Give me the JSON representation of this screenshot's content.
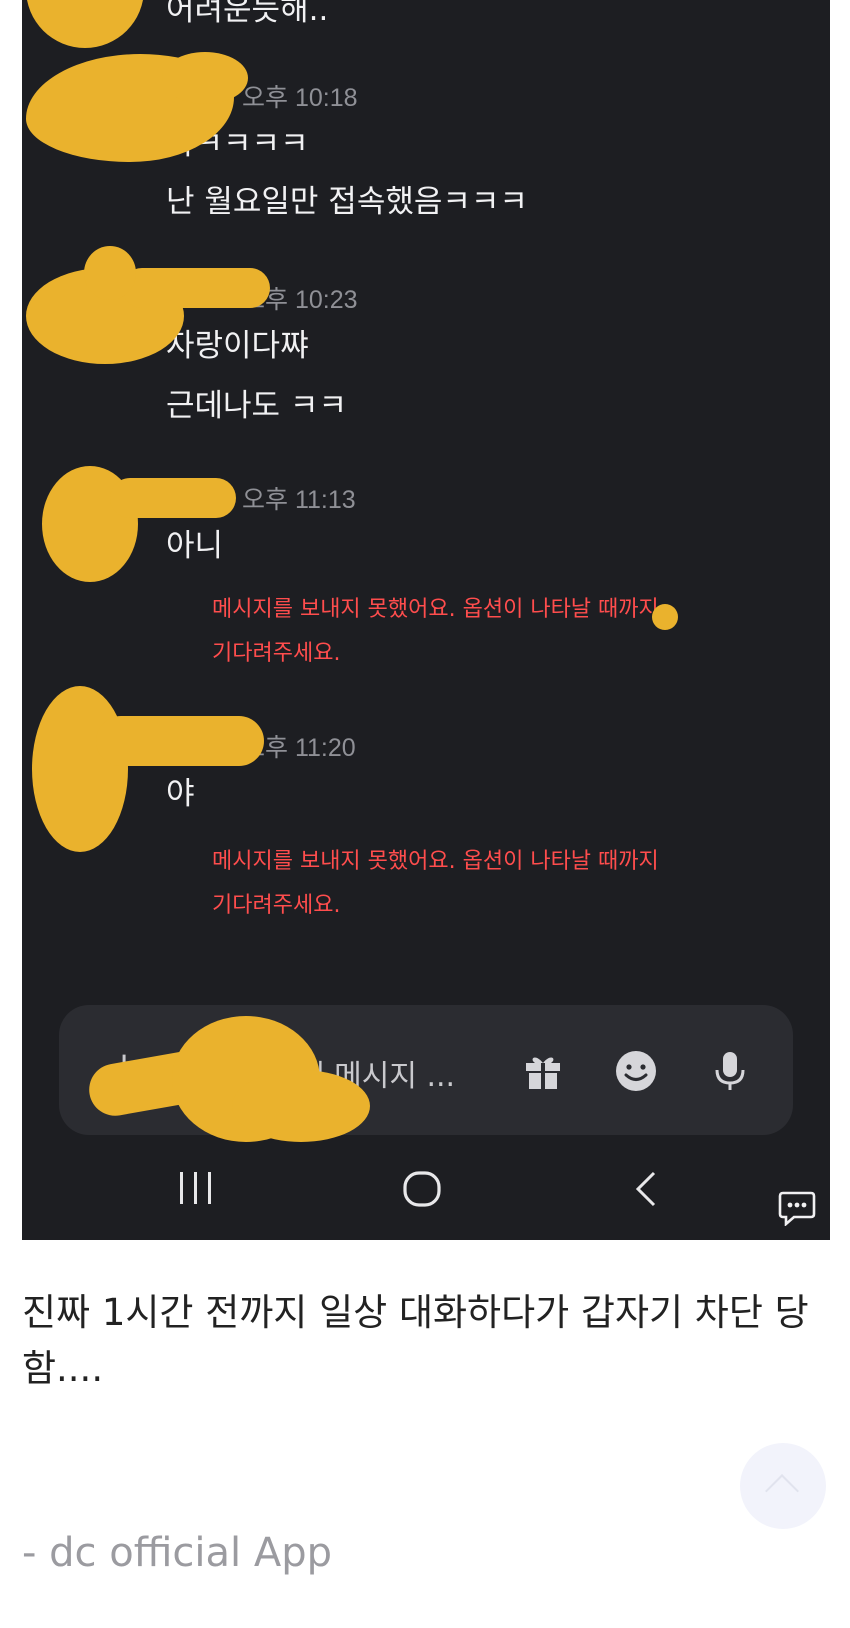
{
  "chat": {
    "top_partial_text": "어려운듯해..",
    "messages": [
      {
        "time": "오후 10:18",
        "lines": [
          "하ㅋㅋㅋㅋ",
          "난 월요일만 접속했음ㅋㅋㅋ"
        ]
      },
      {
        "time": "오후 10:23",
        "lines": [
          "자랑이다쨔",
          "근데나도 ㅋㅋ"
        ]
      },
      {
        "time": "오후 11:13",
        "lines": [
          "아니"
        ],
        "error": [
          "메시지를 보내지 못했어요. 옵션이 나타날 때까지",
          "기다려주세요."
        ]
      },
      {
        "time": "오후 11:20",
        "lines": [
          "야"
        ],
        "error": [
          "메시지를 보내지 못했어요. 옵션이 나타날 때까지",
          "기다려주세요."
        ]
      }
    ],
    "composer": {
      "plus": "+",
      "placeholder": "에 메시지 ...",
      "icons": [
        "gift-icon",
        "emoji-icon",
        "microphone-icon"
      ]
    },
    "navbar": [
      "recent-apps-icon",
      "home-icon",
      "back-icon"
    ],
    "chat_fab_icon": "chat-bubble-icon",
    "colors": {
      "background": "#1d1e22",
      "censor": "#eab22d",
      "error": "#ff4d4d"
    }
  },
  "post": {
    "caption": "진짜 1시간 전까지 일상 대화하다가 갑자기 차단 당함....",
    "signature": "- dc official App"
  }
}
